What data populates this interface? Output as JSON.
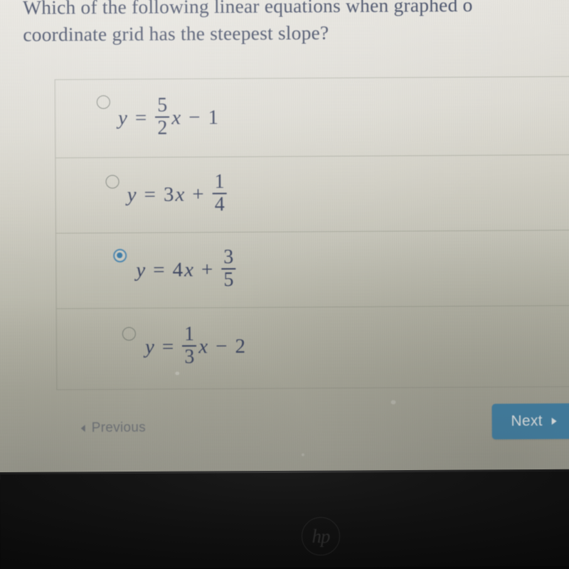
{
  "device": {
    "brand_logo": "hp",
    "bezel_name": "laptop-bezel"
  },
  "quiz": {
    "question": {
      "line1": "Which of the following linear equations when graphed o",
      "line2": "coordinate grid has the steepest slope?"
    },
    "options": [
      {
        "id": "option-a",
        "selected": false,
        "lhs": "y",
        "eq": "=",
        "coefficient_type": "fraction",
        "numerator": "5",
        "denominator": "2",
        "variable": "x",
        "operator": "−",
        "constant": "1",
        "text": "y = 5/2 x − 1"
      },
      {
        "id": "option-b",
        "selected": false,
        "lhs": "y",
        "eq": "=",
        "coefficient_type": "integer",
        "coefficient": "3",
        "variable": "x",
        "operator": "+",
        "constant_numerator": "1",
        "constant_denominator": "4",
        "text": "y = 3x + 1/4"
      },
      {
        "id": "option-c",
        "selected": true,
        "lhs": "y",
        "eq": "=",
        "coefficient_type": "integer",
        "coefficient": "4",
        "variable": "x",
        "operator": "+",
        "constant_numerator": "3",
        "constant_denominator": "5",
        "text": "y = 4x + 3/5"
      },
      {
        "id": "option-d",
        "selected": false,
        "lhs": "y",
        "eq": "=",
        "coefficient_type": "fraction",
        "numerator": "1",
        "denominator": "3",
        "variable": "x",
        "operator": "−",
        "constant": "2",
        "text": "y = 1/3 x − 2"
      }
    ],
    "nav": {
      "previous_label": "Previous",
      "next_label": "Next"
    }
  },
  "colors": {
    "question_text": "#414a63",
    "equation_text": "#3c4560",
    "selected_radio": "#3c7ba6",
    "next_button_bg": "#3f82ab",
    "next_button_text": "#eef3f6",
    "previous_link": "#70747a",
    "screen_bg_top": "#e8e6e0",
    "screen_bg_bottom": "#9e9d92",
    "bezel": "#0b0b0b"
  }
}
